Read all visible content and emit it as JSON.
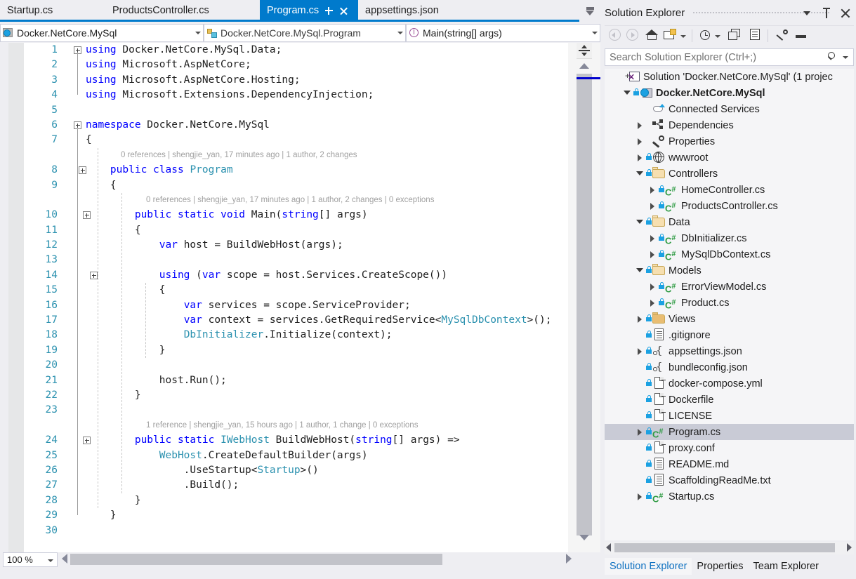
{
  "tabs": [
    {
      "label": "Startup.cs",
      "active": false
    },
    {
      "label": "ProductsController.cs",
      "active": false
    },
    {
      "label": "Program.cs",
      "active": true
    },
    {
      "label": "appsettings.json",
      "active": false
    }
  ],
  "tab_buttons": {
    "pin": "pin-icon",
    "close": "close-icon",
    "tab_list": "tab-list-dropdown-icon"
  },
  "navbar": {
    "project": "Docker.NetCore.MySql",
    "type": "Docker.NetCore.MySql.Program",
    "member": "Main(string[] args)"
  },
  "editor": {
    "zoom": "100 %",
    "lines": [
      {
        "n": "1",
        "text": "using Docker.NetCore.MySql.Data;"
      },
      {
        "n": "2",
        "text": "using Microsoft.AspNetCore;"
      },
      {
        "n": "3",
        "text": "using Microsoft.AspNetCore.Hosting;"
      },
      {
        "n": "4",
        "text": "using Microsoft.Extensions.DependencyInjection;"
      },
      {
        "n": "5",
        "text": ""
      },
      {
        "n": "6",
        "text": "namespace Docker.NetCore.MySql"
      },
      {
        "n": "7",
        "text": "{"
      },
      {
        "n": "8",
        "text": "    public class Program"
      },
      {
        "n": "9",
        "text": "    {"
      },
      {
        "n": "10",
        "text": "        public static void Main(string[] args)"
      },
      {
        "n": "11",
        "text": "        {"
      },
      {
        "n": "12",
        "text": "            var host = BuildWebHost(args);"
      },
      {
        "n": "13",
        "text": ""
      },
      {
        "n": "14",
        "text": "            using (var scope = host.Services.CreateScope())"
      },
      {
        "n": "15",
        "text": "            {"
      },
      {
        "n": "16",
        "text": "                var services = scope.ServiceProvider;"
      },
      {
        "n": "17",
        "text": "                var context = services.GetRequiredService<MySqlDbContext>();"
      },
      {
        "n": "18",
        "text": "                DbInitializer.Initialize(context);"
      },
      {
        "n": "19",
        "text": "            }"
      },
      {
        "n": "20",
        "text": ""
      },
      {
        "n": "21",
        "text": "            host.Run();"
      },
      {
        "n": "22",
        "text": "        }"
      },
      {
        "n": "23",
        "text": ""
      },
      {
        "n": "24",
        "text": "        public static IWebHost BuildWebHost(string[] args) =>"
      },
      {
        "n": "25",
        "text": "            WebHost.CreateDefaultBuilder(args)"
      },
      {
        "n": "26",
        "text": "                .UseStartup<Startup>()"
      },
      {
        "n": "27",
        "text": "                .Build();"
      },
      {
        "n": "28",
        "text": "        }"
      },
      {
        "n": "29",
        "text": "    }"
      },
      {
        "n": "30",
        "text": ""
      }
    ],
    "codelens": [
      {
        "after_line": 7,
        "text": "0 references | shengjie_yan, 17 minutes ago | 1 author, 2 changes"
      },
      {
        "after_line": 9,
        "text": "0 references | shengjie_yan, 17 minutes ago | 1 author, 2 changes | 0 exceptions"
      },
      {
        "after_line": 23,
        "text": "1 reference | shengjie_yan, 15 hours ago | 1 author, 1 change | 0 exceptions"
      }
    ]
  },
  "solution_explorer": {
    "title": "Solution Explorer",
    "header_buttons": [
      "dropdown-icon",
      "pin-icon",
      "close-icon"
    ],
    "toolbar": [
      "back-icon",
      "forward-icon",
      "home-icon",
      "new-folder-icon",
      "new-folder-dropdown-icon",
      "pending-changes-icon",
      "pending-changes-dropdown-icon",
      "collapse-all-icon",
      "show-all-files-icon",
      "properties-icon",
      "preview-selected-items-icon"
    ],
    "search_placeholder": "Search Solution Explorer (Ctrl+;)",
    "search_icons": [
      "search-icon",
      "search-options-dropdown-icon"
    ],
    "tree": [
      {
        "label": "Solution 'Docker.NetCore.MySql' (1 projec",
        "indent": 0,
        "expander": "plus",
        "icon": "solution-icon",
        "lock": false,
        "bold": false,
        "selected": false
      },
      {
        "label": "Docker.NetCore.MySql",
        "indent": 1,
        "expander": "expanded",
        "icon": "project-web-icon",
        "lock": true,
        "bold": true,
        "selected": false
      },
      {
        "label": "Connected Services",
        "indent": 2,
        "expander": "none",
        "icon": "connected-services-icon",
        "lock": false,
        "bold": false,
        "selected": false
      },
      {
        "label": "Dependencies",
        "indent": 2,
        "expander": "collapsed",
        "icon": "dependencies-icon",
        "lock": false,
        "bold": false,
        "selected": false
      },
      {
        "label": "Properties",
        "indent": 2,
        "expander": "collapsed",
        "icon": "wrench-icon",
        "lock": false,
        "bold": false,
        "selected": false
      },
      {
        "label": "wwwroot",
        "indent": 2,
        "expander": "collapsed",
        "icon": "globe-icon",
        "lock": true,
        "bold": false,
        "selected": false
      },
      {
        "label": "Controllers",
        "indent": 2,
        "expander": "expanded",
        "icon": "folder-open-icon",
        "lock": true,
        "bold": false,
        "selected": false
      },
      {
        "label": "HomeController.cs",
        "indent": 3,
        "expander": "collapsed",
        "icon": "csharp-file-icon",
        "lock": true,
        "bold": false,
        "selected": false
      },
      {
        "label": "ProductsController.cs",
        "indent": 3,
        "expander": "collapsed",
        "icon": "csharp-file-icon",
        "lock": true,
        "bold": false,
        "selected": false
      },
      {
        "label": "Data",
        "indent": 2,
        "expander": "expanded",
        "icon": "folder-open-icon",
        "lock": true,
        "bold": false,
        "selected": false
      },
      {
        "label": "DbInitializer.cs",
        "indent": 3,
        "expander": "collapsed",
        "icon": "csharp-file-icon",
        "lock": true,
        "bold": false,
        "selected": false
      },
      {
        "label": "MySqlDbContext.cs",
        "indent": 3,
        "expander": "collapsed",
        "icon": "csharp-file-icon",
        "lock": true,
        "bold": false,
        "selected": false
      },
      {
        "label": "Models",
        "indent": 2,
        "expander": "expanded",
        "icon": "folder-open-icon",
        "lock": true,
        "bold": false,
        "selected": false
      },
      {
        "label": "ErrorViewModel.cs",
        "indent": 3,
        "expander": "collapsed",
        "icon": "csharp-file-icon",
        "lock": true,
        "bold": false,
        "selected": false
      },
      {
        "label": "Product.cs",
        "indent": 3,
        "expander": "collapsed",
        "icon": "csharp-file-icon",
        "lock": true,
        "bold": false,
        "selected": false
      },
      {
        "label": "Views",
        "indent": 2,
        "expander": "collapsed",
        "icon": "folder-closed-icon",
        "lock": true,
        "bold": false,
        "selected": false
      },
      {
        "label": ".gitignore",
        "indent": 2,
        "expander": "none",
        "icon": "text-file-icon",
        "lock": true,
        "bold": false,
        "selected": false
      },
      {
        "label": "appsettings.json",
        "indent": 2,
        "expander": "collapsed",
        "icon": "json-file-icon",
        "lock": true,
        "bold": false,
        "selected": false
      },
      {
        "label": "bundleconfig.json",
        "indent": 2,
        "expander": "none",
        "icon": "json-file-icon",
        "lock": true,
        "bold": false,
        "selected": false
      },
      {
        "label": "docker-compose.yml",
        "indent": 2,
        "expander": "none",
        "icon": "blank-file-icon",
        "lock": true,
        "bold": false,
        "selected": false
      },
      {
        "label": "Dockerfile",
        "indent": 2,
        "expander": "none",
        "icon": "blank-file-icon",
        "lock": true,
        "bold": false,
        "selected": false
      },
      {
        "label": "LICENSE",
        "indent": 2,
        "expander": "none",
        "icon": "blank-file-icon",
        "lock": true,
        "bold": false,
        "selected": false
      },
      {
        "label": "Program.cs",
        "indent": 2,
        "expander": "collapsed",
        "icon": "csharp-file-icon",
        "lock": true,
        "bold": false,
        "selected": true
      },
      {
        "label": "proxy.conf",
        "indent": 2,
        "expander": "none",
        "icon": "blank-file-icon",
        "lock": true,
        "bold": false,
        "selected": false
      },
      {
        "label": "README.md",
        "indent": 2,
        "expander": "none",
        "icon": "text-file-icon",
        "lock": true,
        "bold": false,
        "selected": false
      },
      {
        "label": "ScaffoldingReadMe.txt",
        "indent": 2,
        "expander": "none",
        "icon": "text-file-icon",
        "lock": true,
        "bold": false,
        "selected": false
      },
      {
        "label": "Startup.cs",
        "indent": 2,
        "expander": "collapsed",
        "icon": "csharp-file-icon",
        "lock": true,
        "bold": false,
        "selected": false
      }
    ],
    "bottom_tabs": [
      {
        "label": "Solution Explorer",
        "active": true
      },
      {
        "label": "Properties",
        "active": false
      },
      {
        "label": "Team Explorer",
        "active": false
      }
    ]
  },
  "colors": {
    "accent": "#007acc",
    "keyword": "#0000ff",
    "type": "#2b91af",
    "linenumber": "#2b91af",
    "codelens": "#a0a0a0",
    "selection": "#c9cbd6",
    "chrome": "#eeeef2"
  }
}
